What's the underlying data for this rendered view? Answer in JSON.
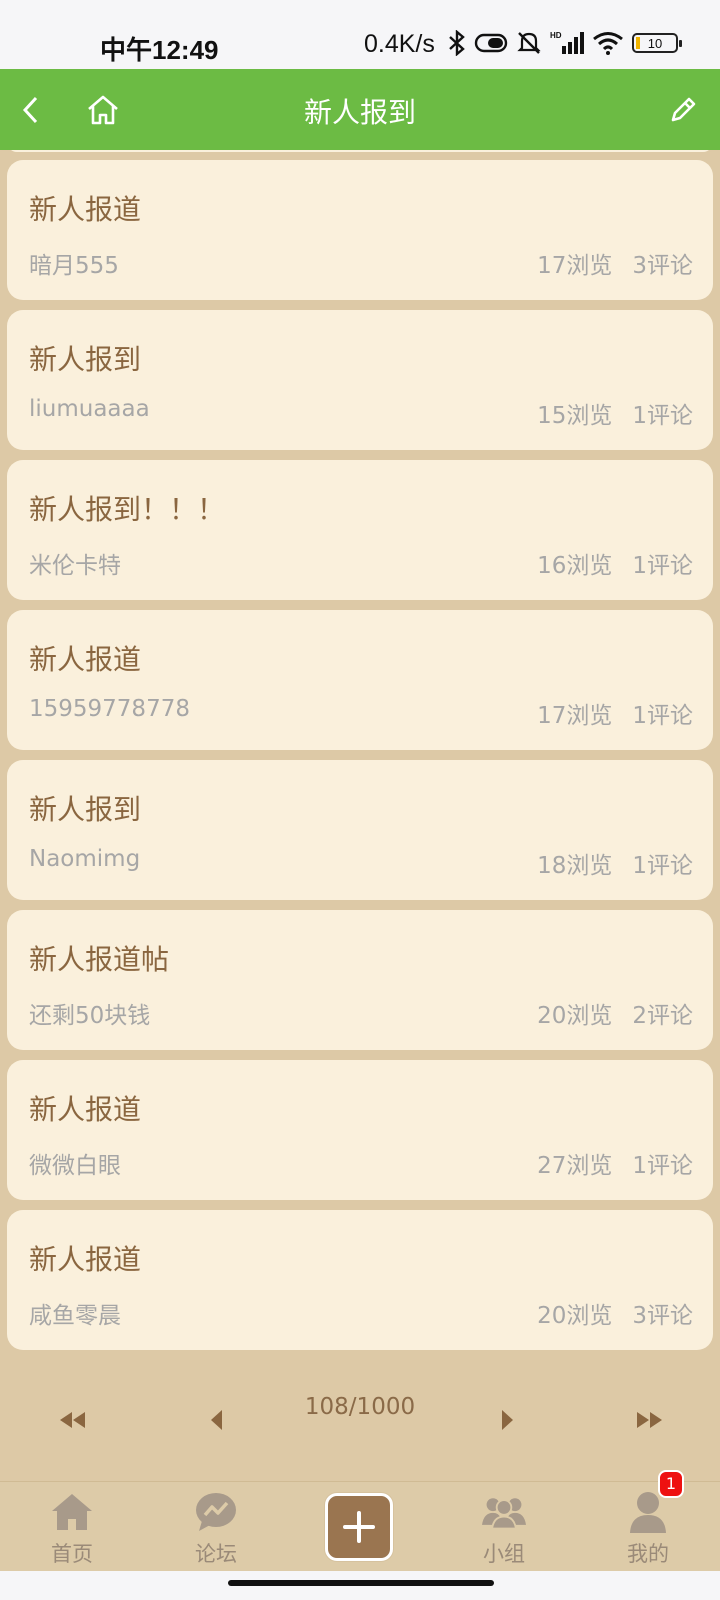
{
  "status_bar": {
    "time": "中午12:49",
    "speed": "0.4K/s",
    "battery": "10"
  },
  "header": {
    "title": "新人报到",
    "back_icon": "back-arrow-icon",
    "home_icon": "home-icon",
    "edit_icon": "edit-pencil-icon"
  },
  "colors": {
    "header_bg": "#6cbb44",
    "page_bg": "#ddc9a6",
    "card_bg": "#faf0dc",
    "title_text": "#8a6640",
    "meta_text": "#a6a6a6",
    "accent_brown": "#9a7550"
  },
  "posts": [
    {
      "title": "新人报道",
      "author": "暗月555",
      "views": "17浏览",
      "comments": "3评论"
    },
    {
      "title": "新人报到",
      "author": "liumuaaaa",
      "views": "15浏览",
      "comments": "1评论"
    },
    {
      "title": "新人报到！！！",
      "author": "米伦卡特",
      "views": "16浏览",
      "comments": "1评论"
    },
    {
      "title": "新人报道",
      "author": "15959778778",
      "views": "17浏览",
      "comments": "1评论"
    },
    {
      "title": "新人报到",
      "author": "Naomimg",
      "views": "18浏览",
      "comments": "1评论"
    },
    {
      "title": "新人报道帖",
      "author": "还剩50块钱",
      "views": "20浏览",
      "comments": "2评论"
    },
    {
      "title": "新人报道",
      "author": "微微白眼",
      "views": "27浏览",
      "comments": "1评论"
    },
    {
      "title": "新人报道",
      "author": "咸鱼零晨",
      "views": "20浏览",
      "comments": "3评论"
    }
  ],
  "pagination": {
    "text": "108/1000",
    "current_page": 108,
    "total_pages": 1000
  },
  "tab_bar": {
    "tabs": [
      {
        "label": "首页",
        "icon": "home-icon"
      },
      {
        "label": "论坛",
        "icon": "forum-chat-icon"
      },
      {
        "label": "",
        "icon": "plus-icon"
      },
      {
        "label": "小组",
        "icon": "group-icon"
      },
      {
        "label": "我的",
        "icon": "profile-icon"
      }
    ],
    "badge": "1"
  }
}
